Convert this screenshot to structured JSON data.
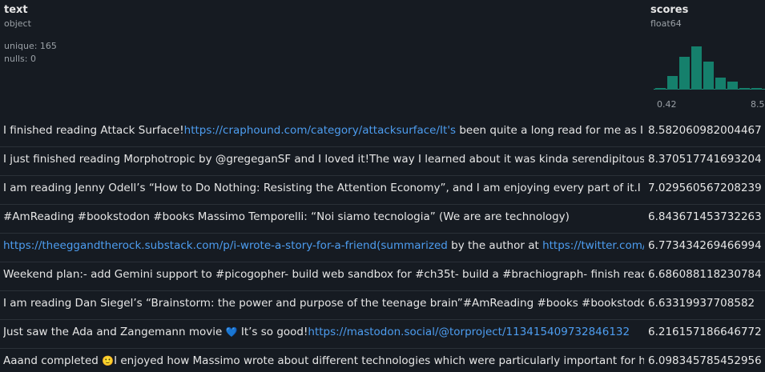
{
  "columns": {
    "text": {
      "name": "text",
      "dtype": "object",
      "unique": "unique: 165",
      "nulls": "nulls: 0"
    },
    "scores": {
      "name": "scores",
      "dtype": "float64",
      "hist_min": "0.42",
      "hist_max": "8.5",
      "histogram": [
        0.03,
        0.28,
        0.68,
        0.9,
        0.58,
        0.25,
        0.16,
        0.04,
        0.04
      ],
      "bar_color": "#15806c"
    }
  },
  "rows": [
    {
      "t1": "I finished reading Attack Surface!",
      "link": "https://craphound.com/category/attacksurface/It's",
      "t2": " been quite a long read for me as I h",
      "score": "8.582060982004467"
    },
    {
      "t1": "I just finished reading Morphotropic by @gregeganSF and I loved it!The way I learned about it was kinda serendipitous",
      "score": "8.370517741693204"
    },
    {
      "t1": "I am reading Jenny Odell’s “How to Do Nothing: Resisting the Attention Economy”, and I am enjoying every part of it.I fo",
      "score": "7.029560567208239"
    },
    {
      "t1": "#AmReading #bookstodon #books Massimo Temporelli: “Noi siamo tecnologia” (We are are technology)",
      "score": "6.843671453732263"
    },
    {
      "link": "https://theeggandtherock.substack.com/p/i-wrote-a-story-for-a-friend(summarized",
      "t2": " by the author at ",
      "link2": "https://twitter.com/",
      "score": "6.773434269466994"
    },
    {
      "t1": "Weekend plan:- add Gemini support to #picogopher- build web sandbox for #ch35t- build a #brachiograph- finish readi",
      "score": "6.686088118230784"
    },
    {
      "t1": "I am reading Dan Siegel’s “Brainstorm: the power and purpose of the teenage brain”#AmReading #books #bookstodon",
      "score": "6.63319937708582"
    },
    {
      "t1": "Just saw the Ada and Zangemann movie ",
      "emoji": "💙",
      "t2": " It’s so good!",
      "link": "https://mastodon.social/@torproject/113415409732846132",
      "score": "6.216157186646772"
    },
    {
      "t1": "Aaand completed ",
      "emoji": "🙂",
      "t2": "I enjoyed how Massimo wrote about different technologies which were particularly important for h",
      "score": "6.098345785452956"
    }
  ]
}
